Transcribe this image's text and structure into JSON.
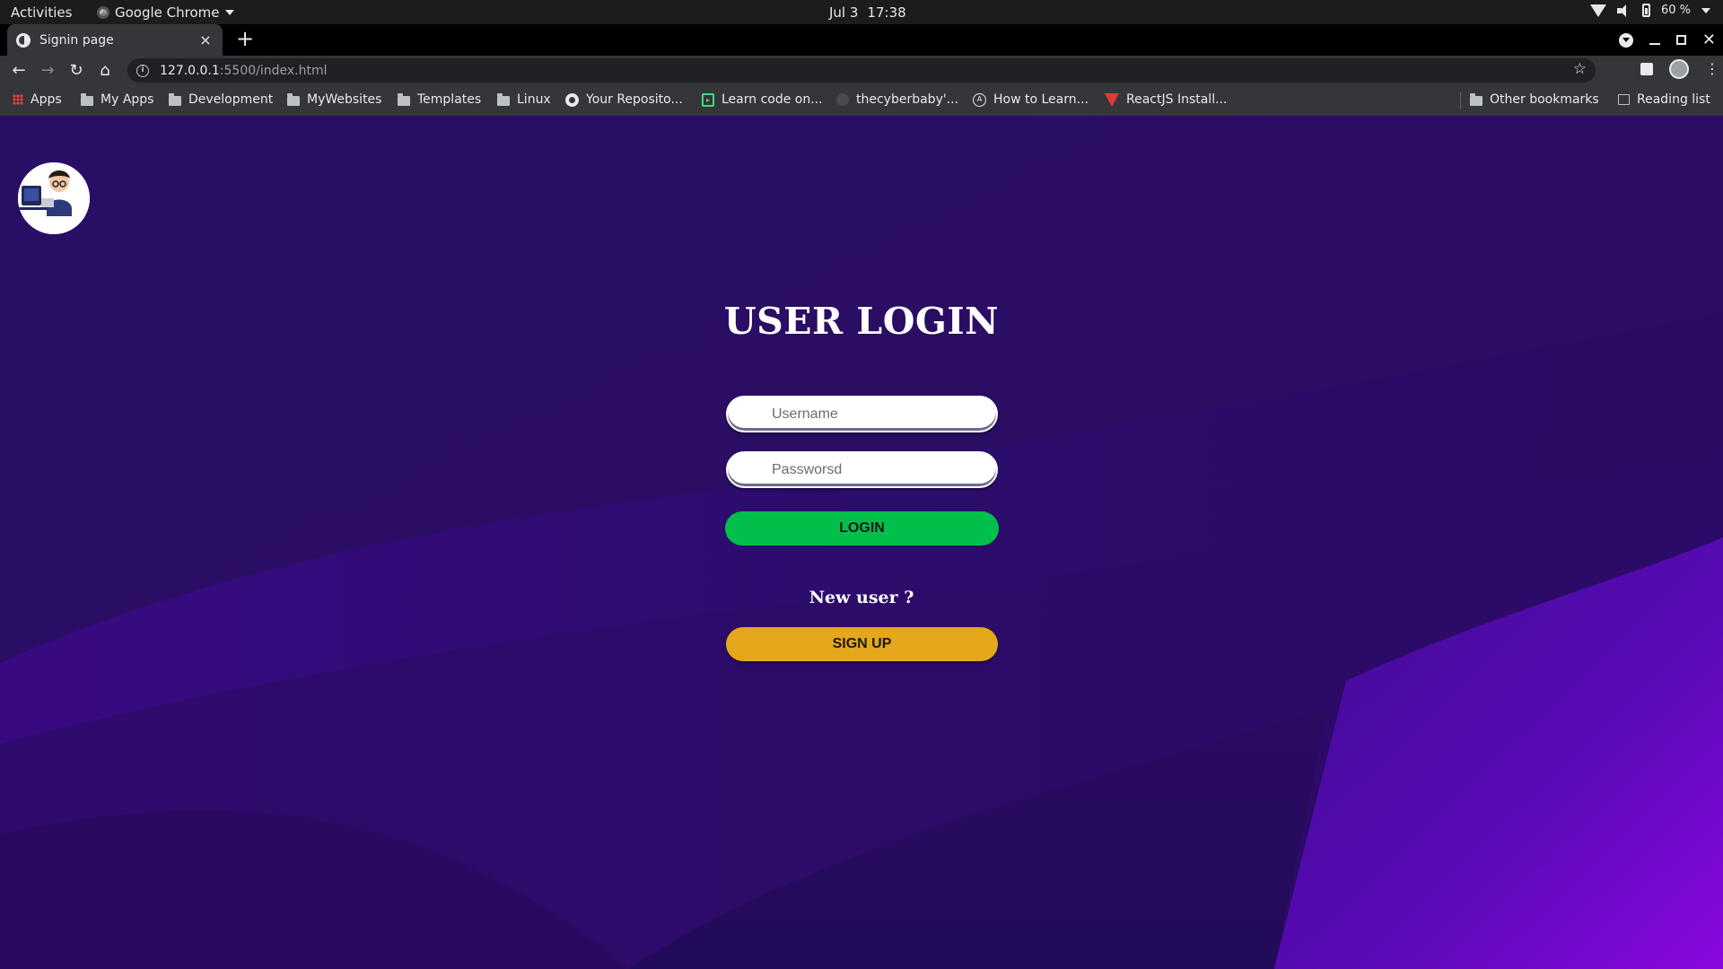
{
  "system_bar": {
    "activities": "Activities",
    "app_name": "Google Chrome",
    "date": "Jul 3",
    "time": "17:38",
    "battery": "60 %"
  },
  "browser": {
    "tab_title": "Signin page",
    "tab_close": "×",
    "new_tab": "+",
    "url_host": "127.0.0.1",
    "url_rest": ":5500/index.html",
    "bookmarks": [
      {
        "label": "Apps",
        "icon": "apps-grid-icon"
      },
      {
        "label": "My Apps",
        "icon": "folder-icon"
      },
      {
        "label": "Development",
        "icon": "folder-icon"
      },
      {
        "label": "MyWebsites",
        "icon": "folder-icon"
      },
      {
        "label": "Templates",
        "icon": "folder-icon"
      },
      {
        "label": "Linux",
        "icon": "folder-icon"
      },
      {
        "label": "Your Reposito...",
        "icon": "github-icon"
      },
      {
        "label": "Learn code on...",
        "icon": "code-icon"
      },
      {
        "label": "thecyberbaby'...",
        "icon": "site-icon"
      },
      {
        "label": "How to Learn...",
        "icon": "angular-icon"
      },
      {
        "label": "ReactJS Install...",
        "icon": "react-icon"
      }
    ],
    "other_bookmarks": "Other bookmarks",
    "reading_list": "Reading list"
  },
  "page": {
    "title": "USER LOGIN",
    "username_placeholder": "Username",
    "password_placeholder": "Passworsd",
    "login_label": "LOGIN",
    "new_user_text": "New user ?",
    "signup_label": "SIGN UP"
  },
  "colors": {
    "background": "#2b0d66",
    "login_button": "#00c04b",
    "signup_button": "#e5a71b"
  }
}
